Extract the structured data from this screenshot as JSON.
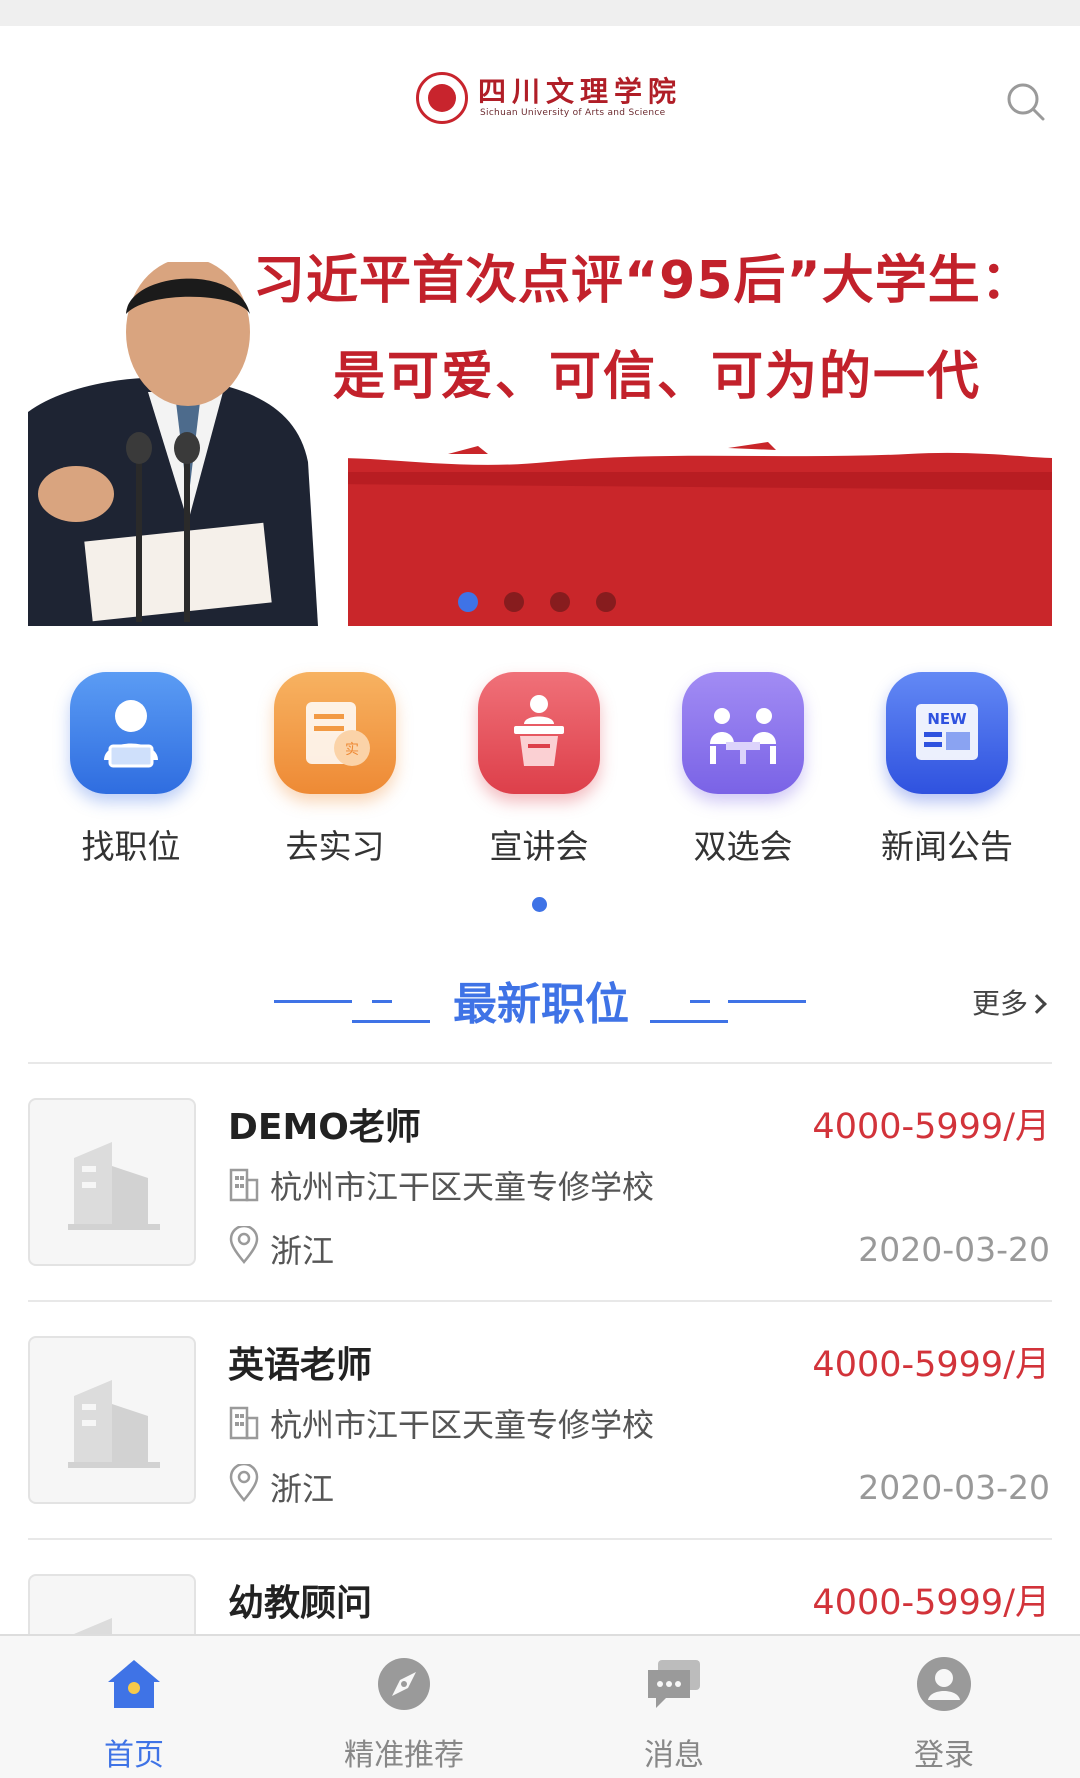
{
  "header": {
    "logo_cn": "四川文理学院",
    "logo_en": "Sichuan University of Arts and Science",
    "search_icon": "search-icon"
  },
  "banner": {
    "line1": "习近平首次点评“95后”大学生：",
    "line2": "是可爱、可信、可为的一代",
    "slide_count": 4,
    "active_slide": 0
  },
  "quick_entries": [
    {
      "label": "找职位",
      "icon": "person-laptop-icon",
      "color": "#3e7fe6"
    },
    {
      "label": "去实习",
      "icon": "internship-document-icon",
      "color": "#f29a45"
    },
    {
      "label": "宣讲会",
      "icon": "podium-icon",
      "color": "#e4535d"
    },
    {
      "label": "双选会",
      "icon": "meeting-icon",
      "color": "#8a72ea"
    },
    {
      "label": "新闻公告",
      "icon": "newspaper-icon",
      "color": "#3d63e8"
    }
  ],
  "section": {
    "title": "最新职位",
    "more": "更多"
  },
  "jobs": [
    {
      "title": "DEMO老师",
      "salary": "4000-5999/月",
      "company": "杭州市江干区天童专修学校",
      "location": "浙江",
      "date": "2020-03-20"
    },
    {
      "title": "英语老师",
      "salary": "4000-5999/月",
      "company": "杭州市江干区天童专修学校",
      "location": "浙江",
      "date": "2020-03-20"
    },
    {
      "title": "幼教顾问",
      "salary": "4000-5999/月",
      "company": "",
      "location": "",
      "date": ""
    }
  ],
  "tabs": [
    {
      "label": "首页",
      "icon": "home-icon",
      "active": true
    },
    {
      "label": "精准推荐",
      "icon": "compass-icon",
      "active": false
    },
    {
      "label": "消息",
      "icon": "chat-bubble-icon",
      "active": false
    },
    {
      "label": "登录",
      "icon": "user-icon",
      "active": false
    }
  ],
  "colors": {
    "accent": "#3f73e6",
    "salary": "#d2333a",
    "brand_red": "#c2212b"
  }
}
